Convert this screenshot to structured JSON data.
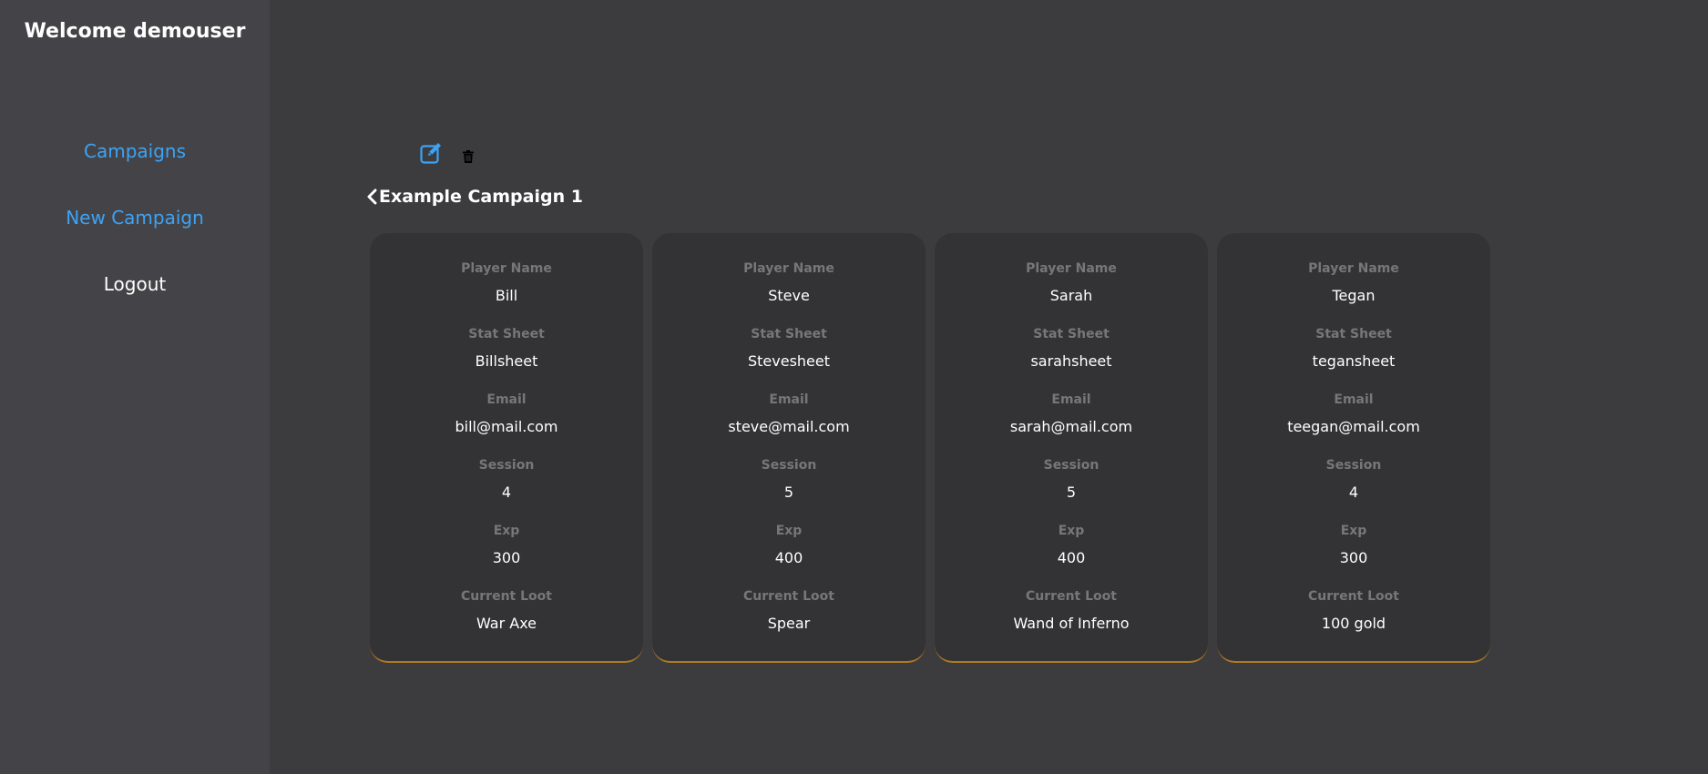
{
  "sidebar": {
    "welcome": "Welcome demouser",
    "nav": [
      {
        "label": "Campaigns"
      },
      {
        "label": "New Campaign"
      },
      {
        "label": "Logout"
      }
    ]
  },
  "campaign": {
    "title": "Example Campaign 1",
    "icons": [
      "edit-icon",
      "trash-icon",
      "chevron-left-icon"
    ]
  },
  "labels": {
    "player_name": "Player Name",
    "stat_sheet": "Stat Sheet",
    "email": "Email",
    "session": "Session",
    "exp": "Exp",
    "current_loot": "Current Loot"
  },
  "players": [
    {
      "player_name": "Bill",
      "stat_sheet": "Billsheet",
      "email": "bill@mail.com",
      "session": "4",
      "exp": "300",
      "current_loot": "War Axe"
    },
    {
      "player_name": "Steve",
      "stat_sheet": "Stevesheet",
      "email": "steve@mail.com",
      "session": "5",
      "exp": "400",
      "current_loot": "Spear"
    },
    {
      "player_name": "Sarah",
      "stat_sheet": "sarahsheet",
      "email": "sarah@mail.com",
      "session": "5",
      "exp": "400",
      "current_loot": "Wand of Inferno"
    },
    {
      "player_name": "Tegan",
      "stat_sheet": "tegansheet",
      "email": "teegan@mail.com",
      "session": "4",
      "exp": "300",
      "current_loot": "100 gold"
    }
  ],
  "colors": {
    "accent": "#3da3f5",
    "card_bottom_border": "#b07a24",
    "background": "#3c3c3e",
    "sidebar": "#444448",
    "card": "#333335"
  }
}
